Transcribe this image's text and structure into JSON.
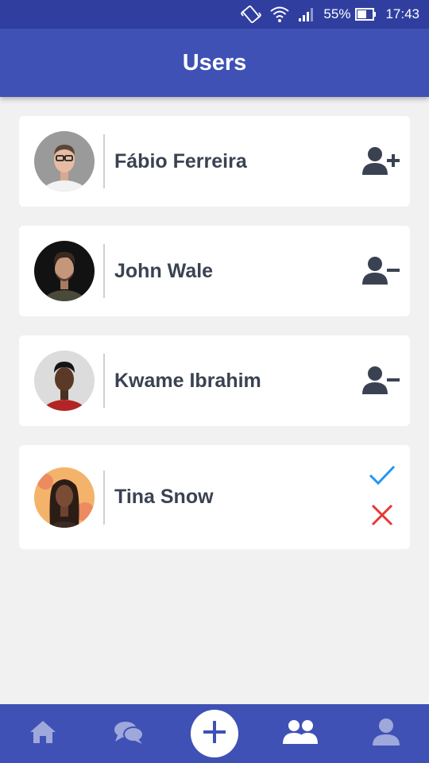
{
  "status_bar": {
    "battery_percent": "55%",
    "time": "17:43",
    "icons": [
      "vibrate-icon",
      "wifi-icon",
      "signal-icon",
      "battery-icon"
    ]
  },
  "app_bar": {
    "title": "Users"
  },
  "users": [
    {
      "name": "Fábio Ferreira",
      "action": "add-user-icon"
    },
    {
      "name": "John Wale",
      "action": "remove-user-icon"
    },
    {
      "name": "Kwame Ibrahim",
      "action": "remove-user-icon"
    },
    {
      "name": "Tina Snow",
      "actions": [
        "accept-check-icon",
        "reject-x-icon"
      ]
    }
  ],
  "bottom_nav": {
    "items": [
      "home-icon",
      "chat-icon",
      "add-icon",
      "users-icon",
      "profile-icon"
    ],
    "active": "users-icon"
  },
  "colors": {
    "primary": "#3f51b5",
    "primary_dark": "#303f9f",
    "text": "#3a4252",
    "accept": "#2196f3",
    "reject": "#e53935",
    "inactive_nav": "#9fa8da"
  }
}
